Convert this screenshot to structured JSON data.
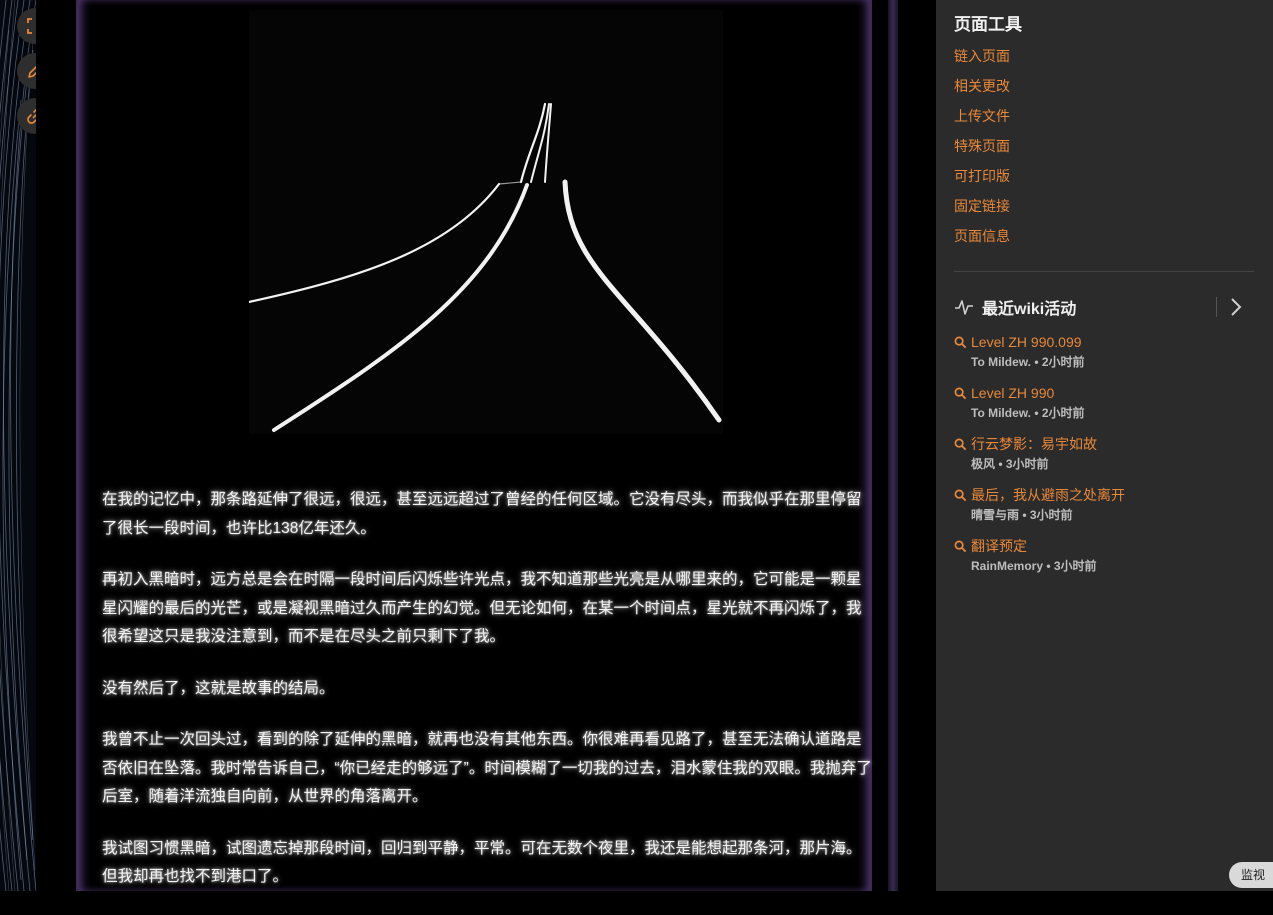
{
  "left_tools": [
    {
      "name": "fullscreen-icon"
    },
    {
      "name": "edit-pencil-icon"
    },
    {
      "name": "link-icon"
    }
  ],
  "story": {
    "image_alt": "",
    "paragraphs": [
      "在我的记忆中，那条路延伸了很远，很远，甚至远远超过了曾经的任何区域。它没有尽头，而我似乎在那里停留了很长一段时间，也许比138亿年还久。",
      "再初入黑暗时，远方总是会在时隔一段时间后闪烁些许光点，我不知道那些光亮是从哪里来的，它可能是一颗星星闪耀的最后的光芒，或是凝视黑暗过久而产生的幻觉。但无论如何，在某一个时间点，星光就不再闪烁了，我很希望这只是我没注意到，而不是在尽头之前只剩下了我。",
      "没有然后了，这就是故事的结局。",
      "我曾不止一次回头过，看到的除了延伸的黑暗，就再也没有其他东西。你很难再看见路了，甚至无法确认道路是否依旧在坠落。我时常告诉自己，“你已经走的够远了”。时间模糊了一切我的过去，泪水蒙住我的双眼。我抛弃了后室，随着洋流独自向前，从世界的角落离开。",
      "我试图习惯黑暗，试图遗忘掉那段时间，回归到平静，平常。可在无数个夜里，我还是能想起那条河，那片海。但我却再也找不到港口了。"
    ]
  },
  "sidebar": {
    "page_tools_title": "页面工具",
    "tools": [
      "链入页面",
      "相关更改",
      "上传文件",
      "特殊页面",
      "可打印版",
      "固定链接",
      "页面信息"
    ],
    "recent_title": "最近wiki活动",
    "activity": [
      {
        "title": "Level ZH 990.099",
        "meta": "To Mildew. • 2小时前"
      },
      {
        "title": "Level ZH 990",
        "meta": "To Mildew. • 2小时前"
      },
      {
        "title": "行云梦影：易宇如故",
        "meta": "极风 • 3小时前"
      },
      {
        "title": "最后，我从避雨之处离开",
        "meta": "晴雪与雨 • 3小时前"
      },
      {
        "title": "翻译预定",
        "meta": "RainMemory • 3小时前"
      }
    ]
  },
  "monitor_label": "监视",
  "colors": {
    "accent": "#e8883a",
    "sidebar_bg": "#2b2b2b",
    "frame_purple": "#3d2a55"
  }
}
